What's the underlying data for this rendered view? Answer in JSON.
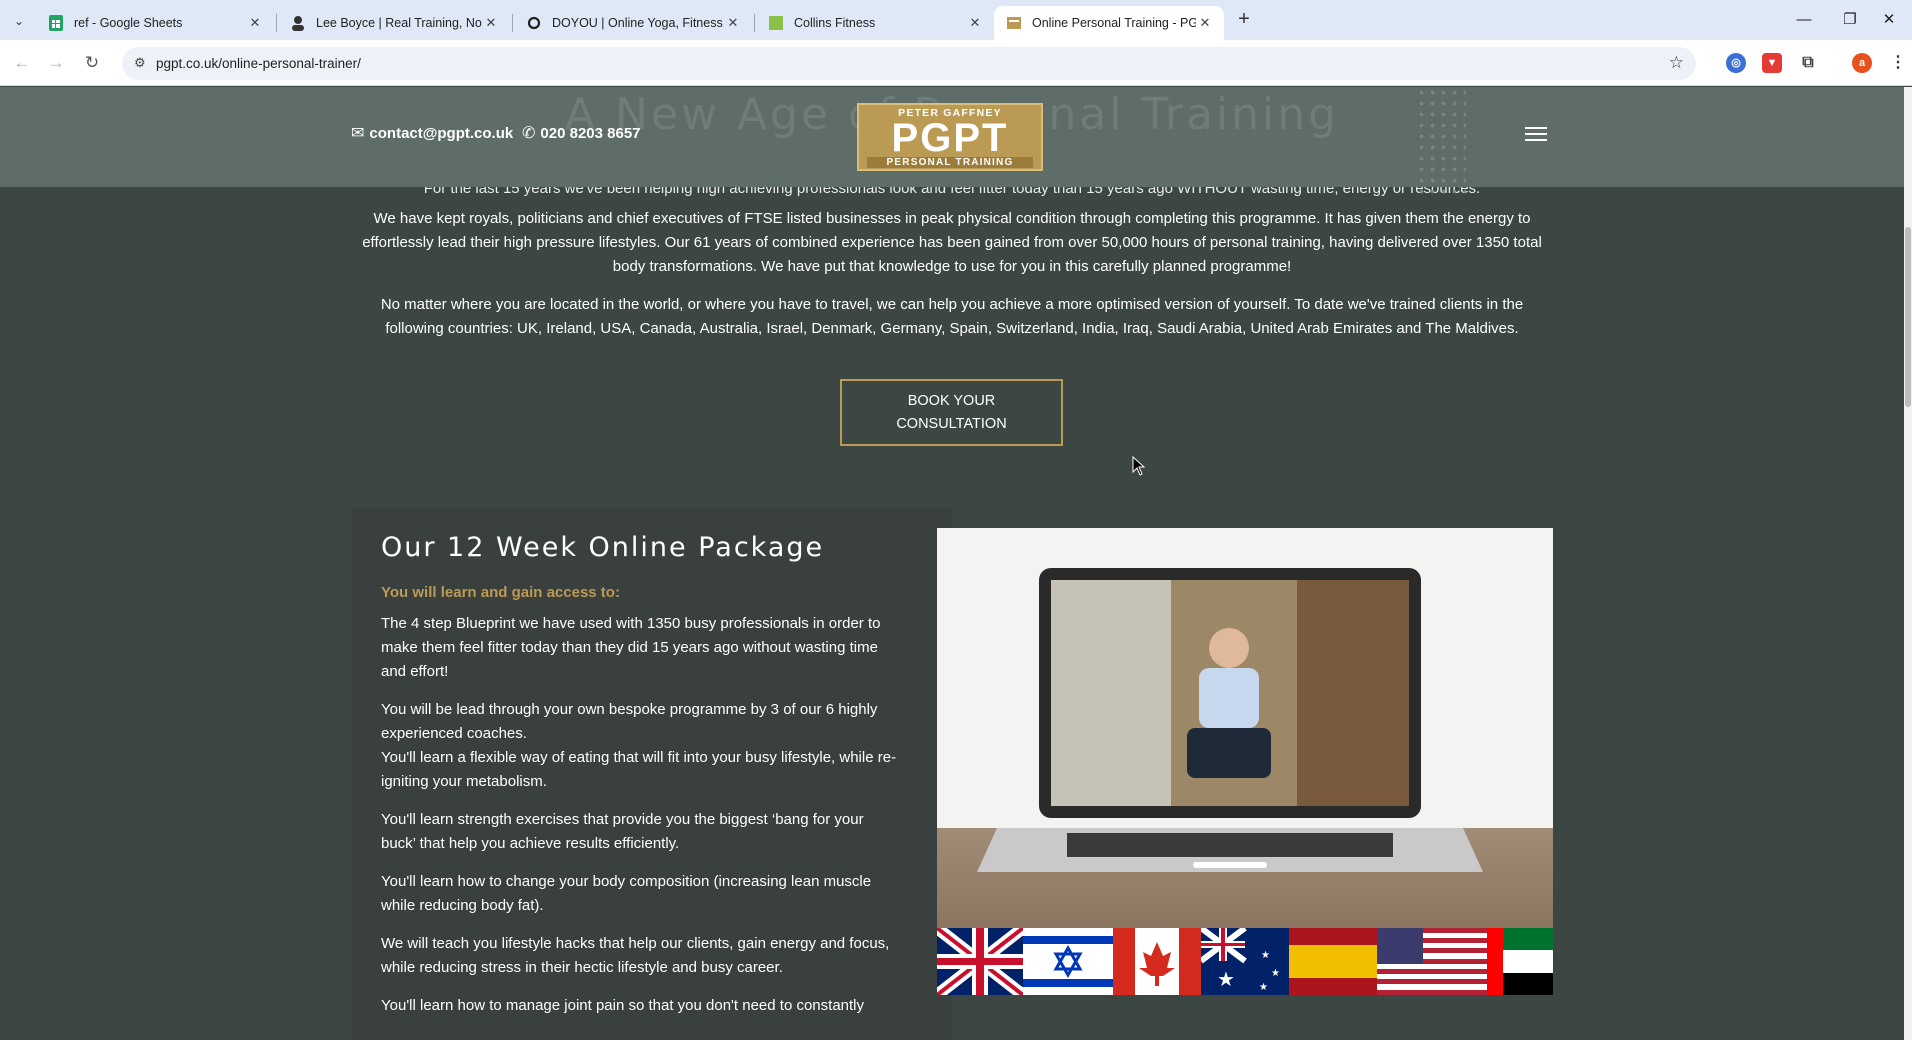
{
  "browser": {
    "tabs": [
      {
        "title": "ref - Google Sheets",
        "icon": "google-sheets-icon",
        "active": false
      },
      {
        "title": "Lee Boyce | Real Training, No N",
        "icon": "person-icon",
        "active": false
      },
      {
        "title": "DOYOU | Online Yoga, Fitness, &",
        "icon": "circle-o-icon",
        "active": false
      },
      {
        "title": "Collins Fitness",
        "icon": "green-square-icon",
        "active": false
      },
      {
        "title": "Online Personal Training - PGPT",
        "icon": "pgpt-favicon",
        "active": true
      }
    ],
    "url": "pgpt.co.uk/online-personal-trainer/",
    "profile_initial": "a"
  },
  "header": {
    "faded_heading": "A New Age of Personal Training",
    "email": "contact@pgpt.co.uk",
    "phone": "020 8203 8657",
    "logo": {
      "line1": "PETER GAFFNEY",
      "line2": "PGPT",
      "line3": "PERSONAL TRAINING"
    }
  },
  "intro": {
    "p0": "For the last 15 years we've been helping high achieving professionals look and feel fitter today than 15 years ago WITHOUT wasting time, energy or resources.",
    "p1": "We have kept royals, politicians and chief executives of FTSE listed businesses in peak physical condition through completing this programme. It has given them the energy to effortlessly lead their high pressure lifestyles. Our 61 years of combined experience has been gained from over 50,000 hours of personal training, having delivered over 1350 total body transformations. We have put that knowledge to use for you in this carefully planned programme!",
    "p2": "No matter where you are located in the world, or where you have to travel, we can help you achieve a more optimised version of yourself. To date we've trained clients in the following countries: UK, Ireland, USA, Canada, Australia, Israel, Denmark, Germany, Spain, Switzerland, India, Iraq, Saudi Arabia, United Arab Emirates and The Maldives."
  },
  "cta": {
    "line1": "BOOK YOUR",
    "line2": "CONSULTATION"
  },
  "package": {
    "title": "Our 12 Week Online Package",
    "subtitle": "You will learn and gain access to:",
    "items": [
      "The 4 step Blueprint we have used with 1350 busy professionals in order to make them feel fitter today than they did 15 years ago without wasting time and effort!",
      "You will be lead through your own bespoke programme by 3 of our 6 highly experienced coaches.",
      "You'll learn a flexible way of eating that will fit into your busy lifestyle, while re-igniting your metabolism.",
      "You'll learn strength exercises that provide you the biggest ‘bang for your buck’ that help you achieve results efficiently.",
      "You'll learn how to change your body composition (increasing lean muscle while reducing body fat).",
      "We will teach you lifestyle hacks that help our clients, gain energy and focus, while reducing stress in their hectic lifestyle and busy career.",
      "You'll learn how to manage joint pain so that you don't need to constantly"
    ]
  },
  "colors": {
    "gold": "#bb9a54",
    "page_bg": "#3c4744",
    "header_bg": "#5f6d68"
  }
}
